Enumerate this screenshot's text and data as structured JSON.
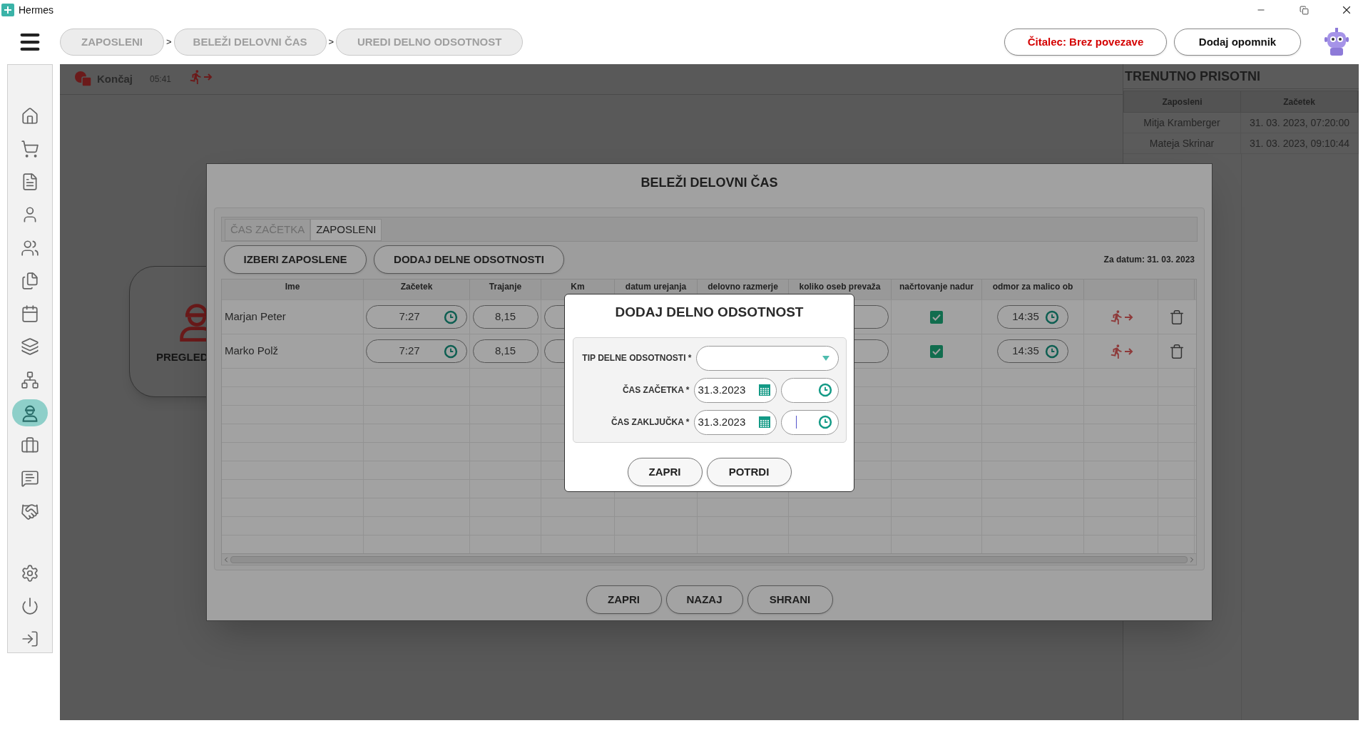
{
  "window": {
    "title": "Hermes"
  },
  "breadcrumbs": [
    "ZAPOSLENI",
    "BELEŽI DELOVNI ČAS",
    "UREDI DELNO ODSOTNOST"
  ],
  "breadcrumb_separators": [
    ">",
    ">"
  ],
  "header_buttons": [
    {
      "label": "Čitalec: Brez povezave",
      "kind": "warning"
    },
    {
      "label": "Dodaj opomnik",
      "kind": "plain"
    }
  ],
  "sidebar": {
    "items": [
      {
        "selected": false
      },
      {
        "selected": false
      },
      {
        "selected": false
      },
      {
        "selected": false
      },
      {
        "selected": false
      },
      {
        "selected": false
      },
      {
        "selected": false
      },
      {
        "selected": false
      },
      {
        "selected": false
      },
      {
        "selected": true
      },
      {
        "selected": false
      },
      {
        "selected": false
      },
      {
        "selected": false
      },
      {
        "selected": false
      },
      {
        "selected": false
      },
      {
        "selected": false
      }
    ]
  },
  "toolbar": {
    "stop_label": "Končaj",
    "timer": "05:41"
  },
  "background_card": {
    "label": "PREGLED"
  },
  "present_panel": {
    "title": "TRENUTNO PRISOTNI",
    "columns": [
      "Zaposleni",
      "Začetek"
    ],
    "rows": [
      [
        "Mitja Kramberger",
        "31. 03. 2023, 07:20:00"
      ],
      [
        "Mateja Skrinar",
        "31. 03. 2023, 09:10:44"
      ]
    ]
  },
  "dialog": {
    "title": "BELEŽI DELOVNI ČAS",
    "tabs": [
      {
        "label": "ČAS ZAČETKA",
        "selected": false
      },
      {
        "label": "ZAPOSLENI",
        "selected": true
      }
    ],
    "actions": [
      "IZBERI ZAPOSLENE",
      "DODAJ DELNE ODSOTNOSTI"
    ],
    "date_note": "Za datum: 31. 03. 2023",
    "table": {
      "columns": [
        "Ime",
        "Začetek",
        "Trajanje",
        "Km",
        "datum urejanja",
        "delovno razmerje",
        "koliko oseb prevaža",
        "načrtovanje nadur",
        "odmor za malico ob"
      ],
      "rows": [
        {
          "name": "Marjan Peter",
          "start": "7:27",
          "duration": "8,15",
          "overtime_planned": true,
          "lunch_break": "14:35"
        },
        {
          "name": "Marko Polž",
          "start": "7:27",
          "duration": "8,15",
          "overtime_planned": true,
          "lunch_break": "14:35"
        }
      ]
    },
    "buttons": [
      "ZAPRI",
      "NAZAJ",
      "SHRANI"
    ]
  },
  "absence_dialog": {
    "title": "DODAJ DELNO ODSOTNOST",
    "type_label": "TIP DELNE ODSOTNOSTI *",
    "start_label": "ČAS ZAČETKA *",
    "start_date": "31.3.2023",
    "end_label": "ČAS ZAKLJUČKA *",
    "end_date": "31.3.2023",
    "buttons": [
      "ZAPRI",
      "POTRDI"
    ]
  }
}
